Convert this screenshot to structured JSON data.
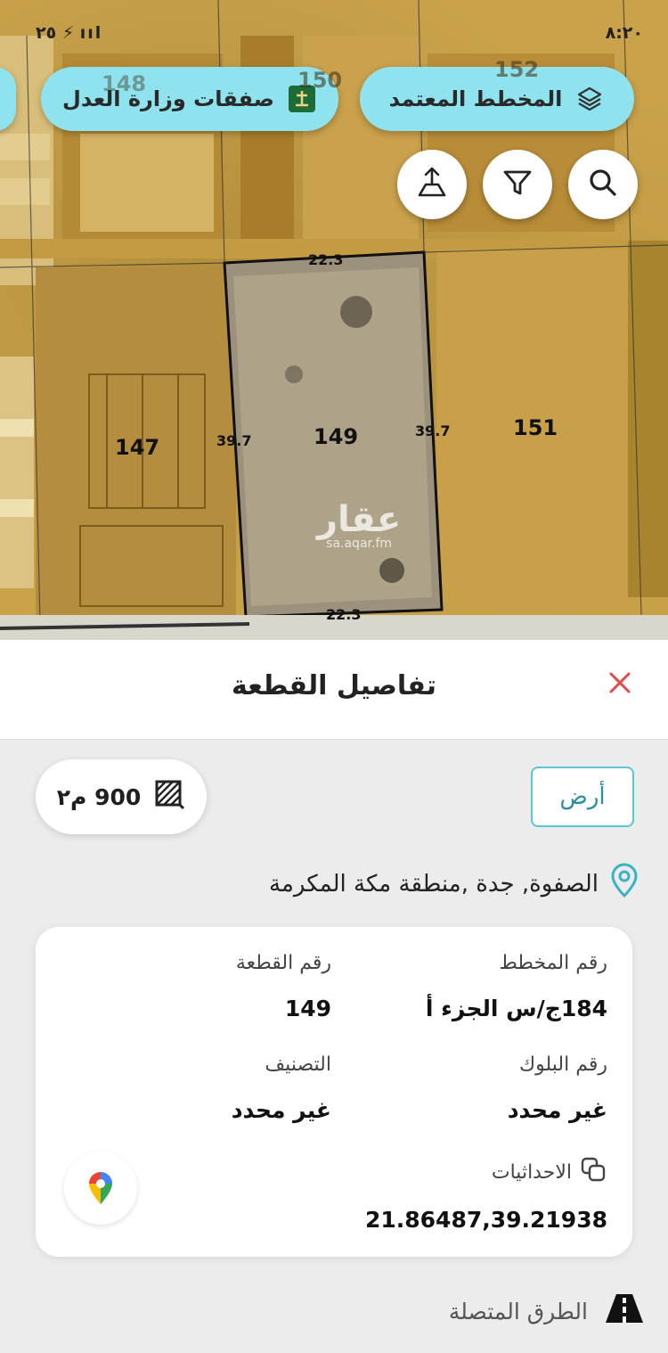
{
  "status_bar": {
    "time": "٨:٢٠",
    "left_text": "٢٥ ⚡ ııl"
  },
  "map_buttons": {
    "approved_plan_label": "المخطط المعتمد",
    "moj_deals_label": "صفقات وزارة العدل"
  },
  "map": {
    "plots": {
      "p147": "147",
      "p149": "149",
      "p151": "151",
      "p150": "150",
      "p152": "152",
      "p148": "148"
    },
    "dimensions": {
      "top": "22.3",
      "bottom": "22.3",
      "left": "39.7",
      "right": "39.7"
    },
    "watermark_logo": "عقار",
    "watermark_url": "sa.aqar.fm"
  },
  "sheet": {
    "title": "تفاصيل القطعة",
    "type_chip": "أرض",
    "area": "900 م٢",
    "location": "الصفوة, جدة ,منطقة مكة المكرمة",
    "details": {
      "plan_number_label": "رقم المخطط",
      "plan_number_value": "184ج/س الجزء أ",
      "plot_number_label": "رقم القطعة",
      "plot_number_value": "149",
      "block_number_label": "رقم البلوك",
      "block_number_value": "غير محدد",
      "classification_label": "التصنيف",
      "classification_value": "غير محدد",
      "coordinates_label": "الاحداثيات",
      "coordinates_value": "21.86487,39.21938"
    },
    "connected_roads": "الطرق المتصلة"
  },
  "colors": {
    "accent": "#8fe3ef",
    "chip_border": "#5bc6d4",
    "close": "#e5484d"
  }
}
